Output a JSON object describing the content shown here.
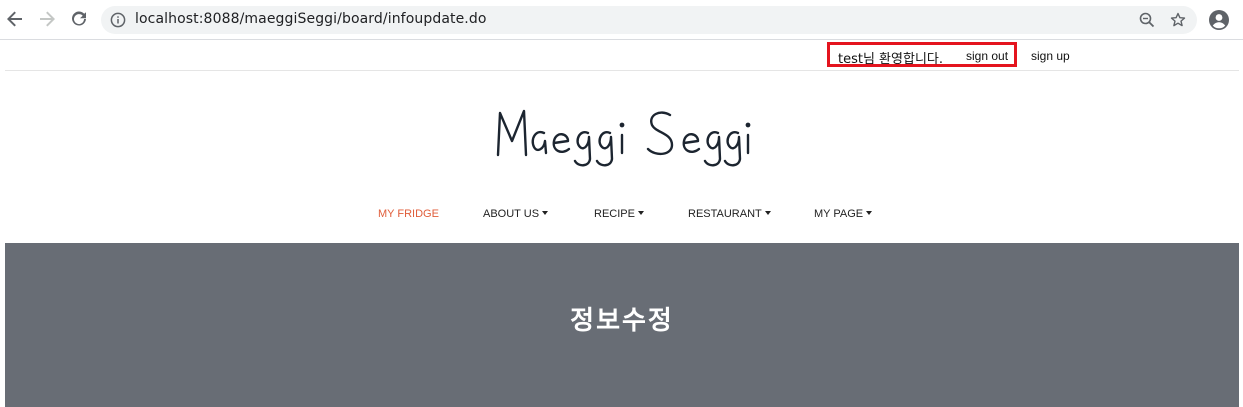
{
  "browser": {
    "url": "localhost:8088/maeggiSeggi/board/infoupdate.do"
  },
  "user_bar": {
    "welcome": "test님 환영합니다.",
    "sign_out": "sign out",
    "sign_up": "sign up",
    "highlight_color": "#e4141e"
  },
  "site": {
    "logo": "Maeggi Seggi"
  },
  "nav": {
    "items": [
      {
        "label": "MY FRIDGE"
      },
      {
        "label": "ABOUT US"
      },
      {
        "label": "RECIPE"
      },
      {
        "label": "RESTAURANT"
      },
      {
        "label": "MY PAGE"
      }
    ],
    "active_color": "#e05d3a"
  },
  "banner": {
    "title": "정보수정",
    "background": "#686d75"
  }
}
